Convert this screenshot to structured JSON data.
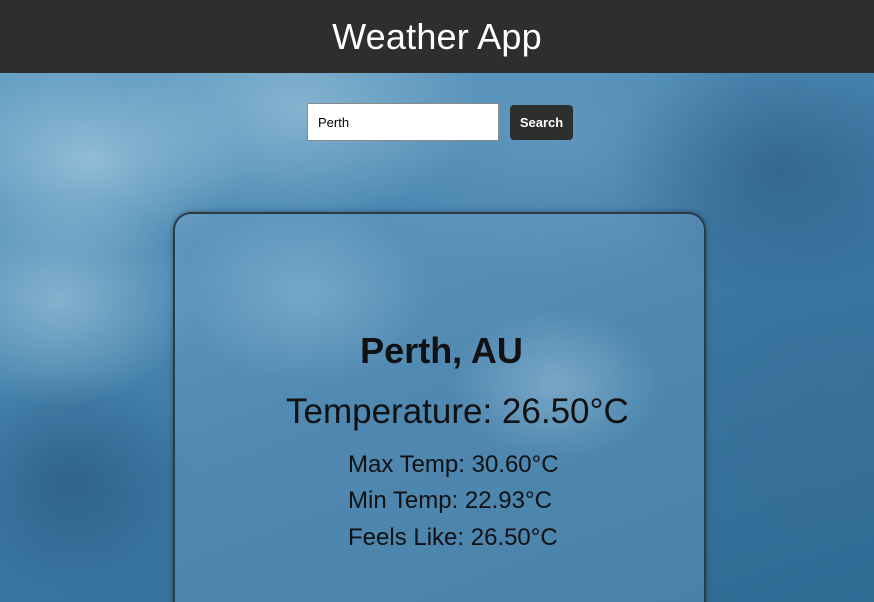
{
  "header": {
    "title": "Weather App"
  },
  "search": {
    "value": "Perth",
    "button_label": "Search"
  },
  "weather": {
    "location": "Perth, AU",
    "temperature": "Temperature: 26.50°C",
    "max_temp": "Max Temp: 30.60°C",
    "min_temp": "Min Temp: 22.93°C",
    "feels_like": "Feels Like: 26.50°C"
  }
}
